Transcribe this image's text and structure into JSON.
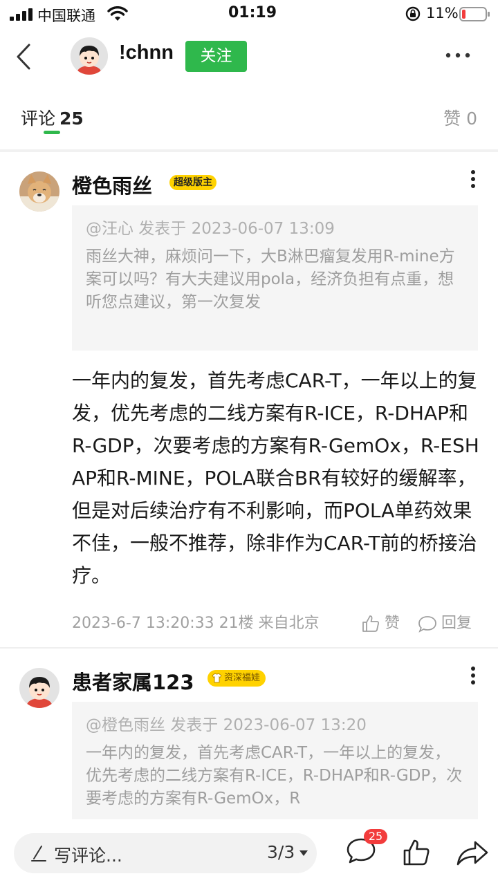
{
  "status_bar": {
    "carrier": "中国联通",
    "time": "01:19",
    "battery": "11%"
  },
  "nav": {
    "username": "!chnn",
    "follow_label": "关注"
  },
  "tabs": {
    "comments_label": "评论",
    "comments_count": "25",
    "likes_label": "赞 0"
  },
  "comments": [
    {
      "author": "橙色雨丝",
      "badge": "超级版主",
      "quote_head": "@汪心 发表于 2023-06-07 13:09",
      "quote_body": "雨丝大神，麻烦问一下，大B淋巴瘤复发用R-mine方案可以吗？有大夫建议用pola，经济负担有点重，想听您点建议，第一次复发",
      "body": "一年内的复发，首先考虑CAR-T，一年以上的复发，优先考虑的二线方案有R-ICE，R-DHAP和R-GDP，次要考虑的方案有R-GemOx，R-ESHAP和R-MINE，POLA联合BR有较好的缓解率，但是对后续治疗有不利影响，而POLA单药效果不佳，一般不推荐，除非作为CAR-T前的桥接治疗。",
      "meta": "2023-6-7 13:20:33  21楼  来自北京",
      "like_label": "赞",
      "reply_label": "回复"
    },
    {
      "author": "患者家属123",
      "badge": "资深福娃",
      "quote_head": "@橙色雨丝 发表于 2023-06-07 13:20",
      "quote_body": "一年内的复发，首先考虑CAR-T，一年以上的复发，优先考虑的二线方案有R-ICE，R-DHAP和R-GDP，次要考虑的方案有R-GemOx，R"
    }
  ],
  "bottom_bar": {
    "input_placeholder": "写评论...",
    "page_indicator": "3/3",
    "comments_badge": "25"
  },
  "colors": {
    "accent_green": "#2fb84c",
    "badge_yellow": "#ffd200",
    "badge_red": "#f23c3c"
  }
}
